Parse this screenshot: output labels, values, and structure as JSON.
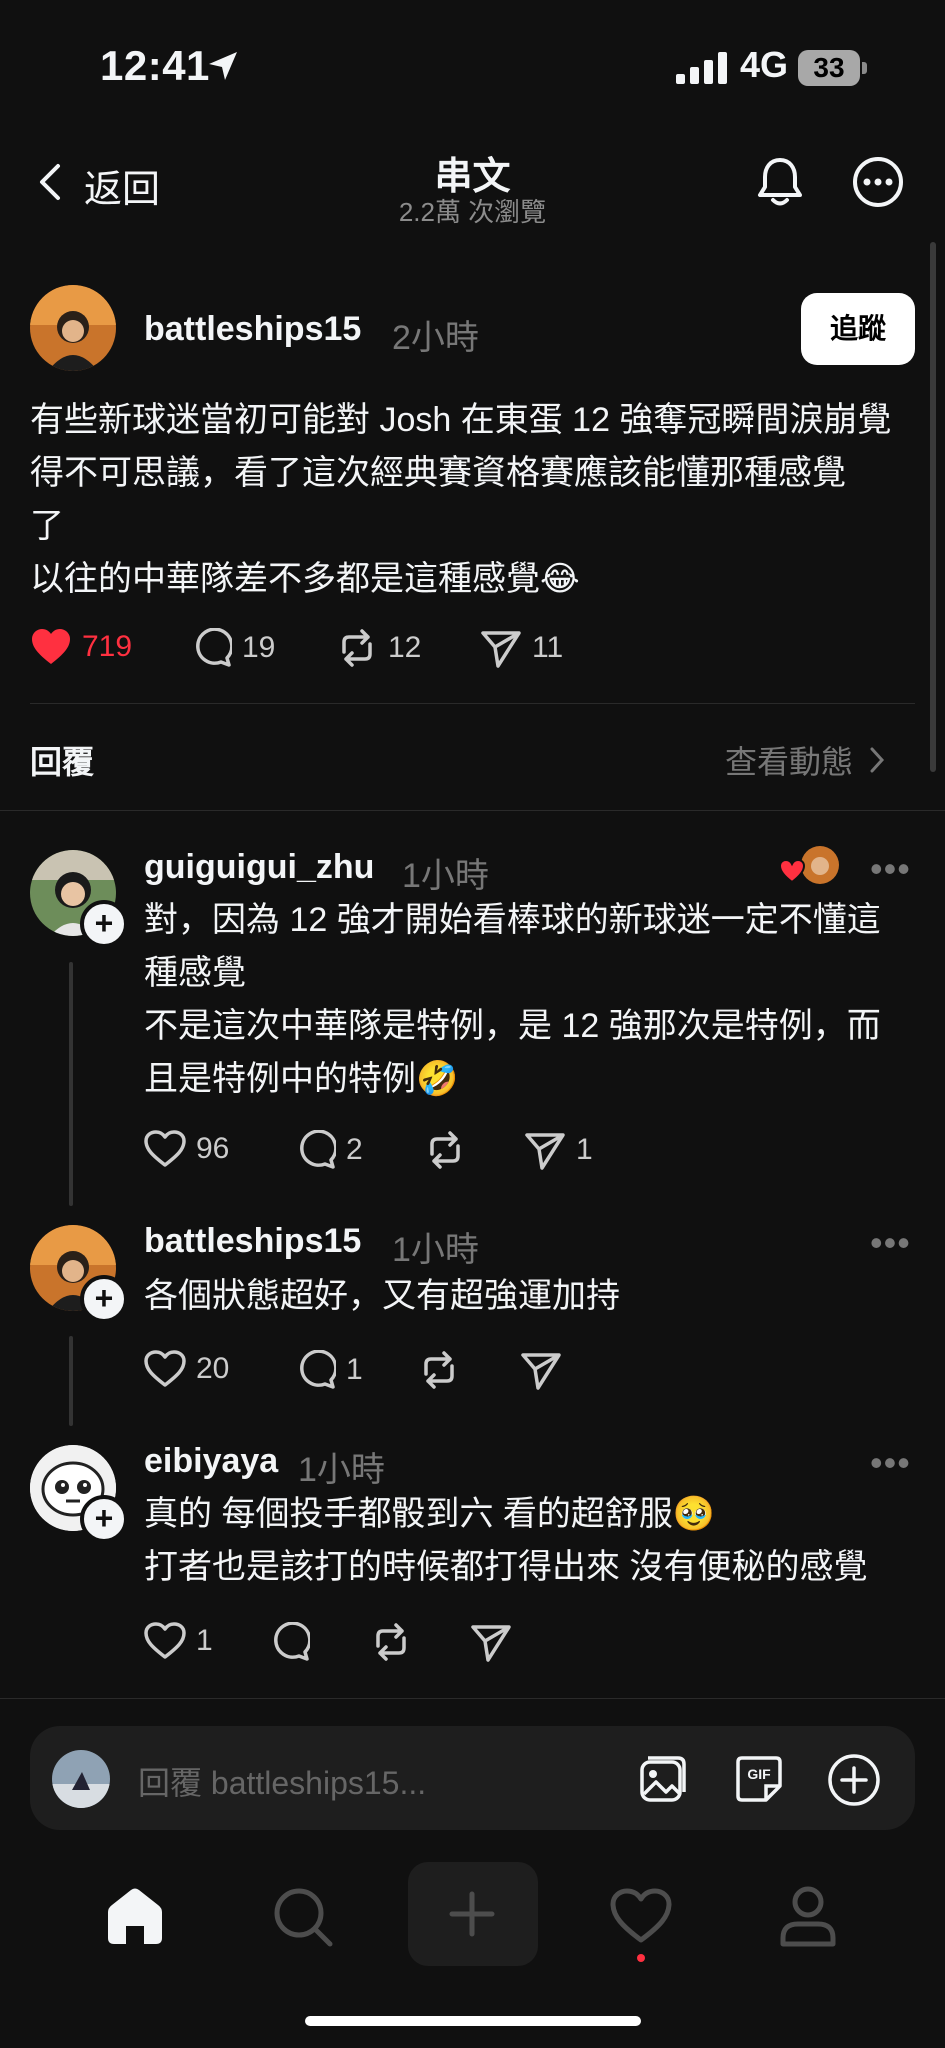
{
  "status_bar": {
    "time": "12:41",
    "network": "4G",
    "battery": "33"
  },
  "header": {
    "back_label": "返回",
    "title": "串文",
    "views": "2.2萬 次瀏覽"
  },
  "post": {
    "username": "battleships15",
    "time": "2小時",
    "follow_label": "追蹤",
    "text": "有些新球迷當初可能對 Josh 在東蛋 12 強奪冠瞬間淚崩覺\n得不可思議，看了這次經典賽資格賽應該能懂那種感覺\n了\n以往的中華隊差不多都是這種感覺😂",
    "likes": "719",
    "comments": "19",
    "reposts": "12",
    "shares": "11"
  },
  "replies_header": {
    "label": "回覆",
    "activity_label": "查看動態"
  },
  "replies": [
    {
      "username": "guiguigui_zhu",
      "time": "1小時",
      "text": "對，因為 12 強才開始看棒球的新球迷一定不懂這\n種感覺\n不是這次中華隊是特例，是 12 強那次是特例，而\n且是特例中的特例🤣",
      "likes": "96",
      "comments": "2",
      "reposts": "",
      "shares": "1"
    },
    {
      "username": "battleships15",
      "time": "1小時",
      "text": "各個狀態超好，又有超強運加持",
      "likes": "20",
      "comments": "1",
      "reposts": "",
      "shares": ""
    },
    {
      "username": "eibiyaya",
      "time": "1小時",
      "text": "真的 每個投手都骰到六 看的超舒服🥹\n打者也是該打的時候都打得出來 沒有便秘的感覺",
      "likes": "1",
      "comments": "",
      "reposts": "",
      "shares": ""
    }
  ],
  "composer": {
    "placeholder": "回覆 battleships15..."
  },
  "icons": {
    "liked": "heart-filled-icon",
    "comment": "speech-bubble-icon",
    "repost": "repost-icon",
    "share": "paper-plane-icon"
  },
  "colors": {
    "background": "#101010",
    "like_red": "#ff3040",
    "text": "#f3f5f7",
    "muted": "#777777"
  }
}
